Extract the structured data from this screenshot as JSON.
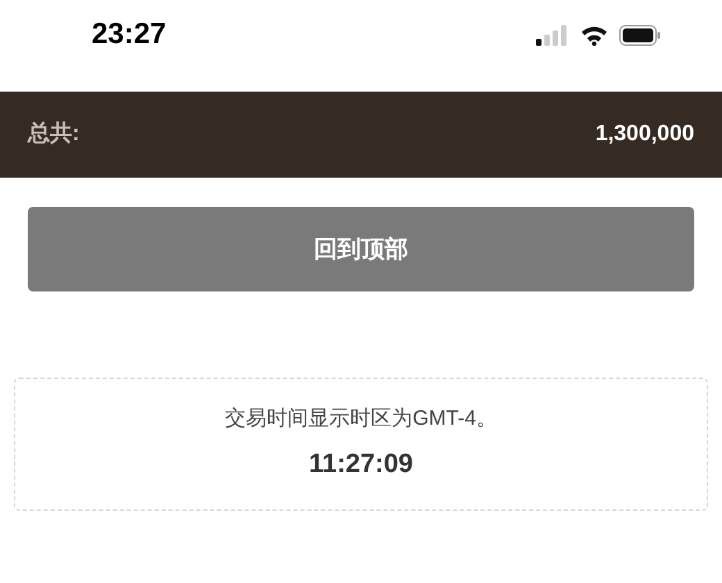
{
  "status_bar": {
    "time": "23:27"
  },
  "total": {
    "label": "总共:",
    "value": "1,300,000"
  },
  "back_to_top_button": {
    "label": "回到顶部"
  },
  "timezone_notice": {
    "text": "交易时间显示时区为GMT-4。",
    "time": "11:27:09"
  }
}
